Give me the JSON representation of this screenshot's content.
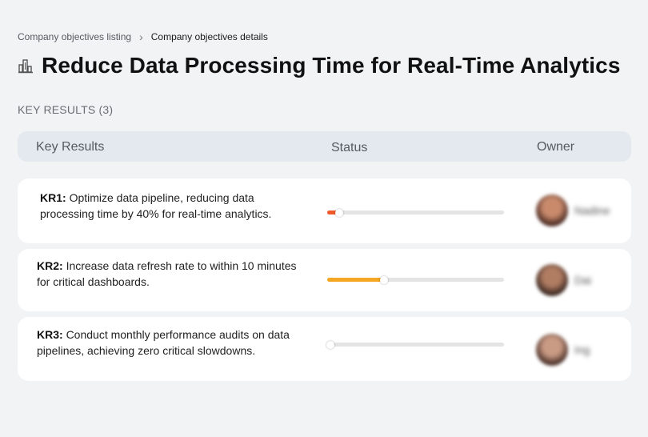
{
  "breadcrumb": {
    "parent": "Company objectives listing",
    "separator": "›",
    "current": "Company objectives details"
  },
  "objective": {
    "icon": "building-chart-icon",
    "title": "Reduce Data Processing Time for Real-Time Analytics"
  },
  "key_results_label": "KEY RESULTS (3)",
  "table": {
    "headers": {
      "key_results": "Key Results",
      "status": "Status",
      "owner": "Owner"
    }
  },
  "key_results": [
    {
      "code": "KR1:",
      "text": "Optimize data pipeline, reducing data processing time by 40% for real-time analytics.",
      "progress": 0.07,
      "progress_color": "#f05a2a",
      "owner": "Nadine",
      "avatar_colors": [
        "#c98a6c",
        "#4a2a22"
      ]
    },
    {
      "code": "KR2:",
      "text": "Increase data refresh rate to within 10 minutes for critical dashboards.",
      "progress": 0.32,
      "progress_color": "#f5a623",
      "owner": "Dai",
      "avatar_colors": [
        "#b07c62",
        "#3a2620"
      ]
    },
    {
      "code": "KR3:",
      "text": "Conduct monthly performance audits on data pipelines, achieving zero critical slowdowns.",
      "progress": 0.02,
      "progress_color": "#f05a2a",
      "owner": "Ing",
      "avatar_colors": [
        "#c99a84",
        "#4a3028"
      ]
    }
  ]
}
